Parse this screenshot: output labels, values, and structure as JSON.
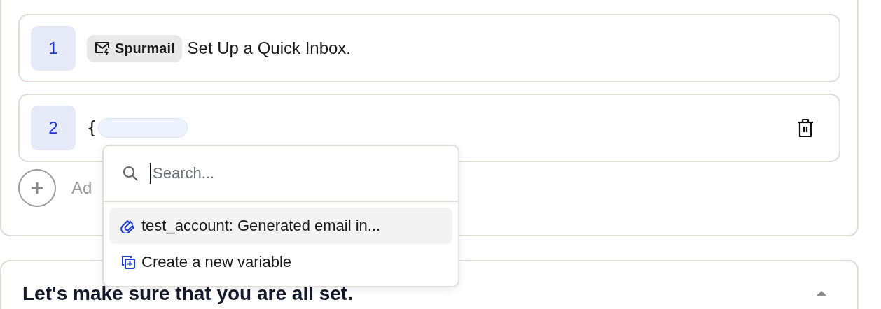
{
  "steps": [
    {
      "number": "1",
      "kind": "text",
      "chip": "Spurmail",
      "text": "Set Up a Quick Inbox.",
      "has_delete_button": false
    },
    {
      "number": "2",
      "kind": "variable",
      "text": "{",
      "has_delete_button": true
    }
  ],
  "add_step": {
    "label": "Ad"
  },
  "variable_menu": {
    "search": {
      "placeholder": "Search..."
    },
    "options": [
      {
        "kind": "variable",
        "label": "test_account: Generated email in...",
        "selected": true
      },
      {
        "kind": "create",
        "label": "Create a new variable",
        "selected": false
      }
    ]
  },
  "checklist_section": {
    "title": "Let's make sure that you are all set.",
    "expanded": true
  }
}
